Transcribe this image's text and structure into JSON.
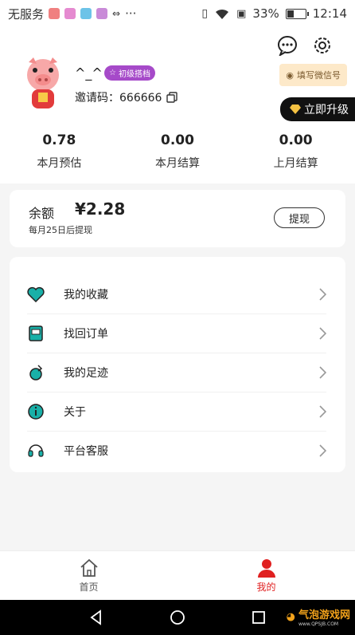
{
  "status_bar": {
    "carrier": "无服务",
    "battery_text": "33%",
    "battery_level": 0.33,
    "time": "12:14",
    "more": "···"
  },
  "header": {
    "wechat_label": "填写微信号",
    "upgrade_label": "立即升级",
    "nickname": "^_^",
    "level": "初级搭档",
    "invite_label": "邀请码：",
    "invite_code": "666666"
  },
  "stats": [
    {
      "value": "0.78",
      "label": "本月预估"
    },
    {
      "value": "0.00",
      "label": "本月结算"
    },
    {
      "value": "0.00",
      "label": "上月结算"
    }
  ],
  "balance": {
    "title": "余额",
    "amount": "¥2.28",
    "note": "每月25日后提现",
    "withdraw_label": "提现"
  },
  "menu": [
    {
      "label": "我的收藏",
      "icon": "heart-icon"
    },
    {
      "label": "找回订单",
      "icon": "order-icon"
    },
    {
      "label": "我的足迹",
      "icon": "footprint-icon"
    },
    {
      "label": "关于",
      "icon": "info-icon"
    },
    {
      "label": "平台客服",
      "icon": "headset-icon"
    }
  ],
  "bottom_nav": [
    {
      "label": "首页",
      "icon": "home-icon"
    },
    {
      "label": "我的",
      "icon": "profile-icon"
    }
  ],
  "watermark": {
    "text": "气泡游戏网",
    "sub": "www.QPSJB.COM"
  },
  "colors": {
    "accent": "#e02020",
    "teal": "#19b0a8",
    "badge": "#a64ac9",
    "wechat_bg": "#fde9c9"
  }
}
